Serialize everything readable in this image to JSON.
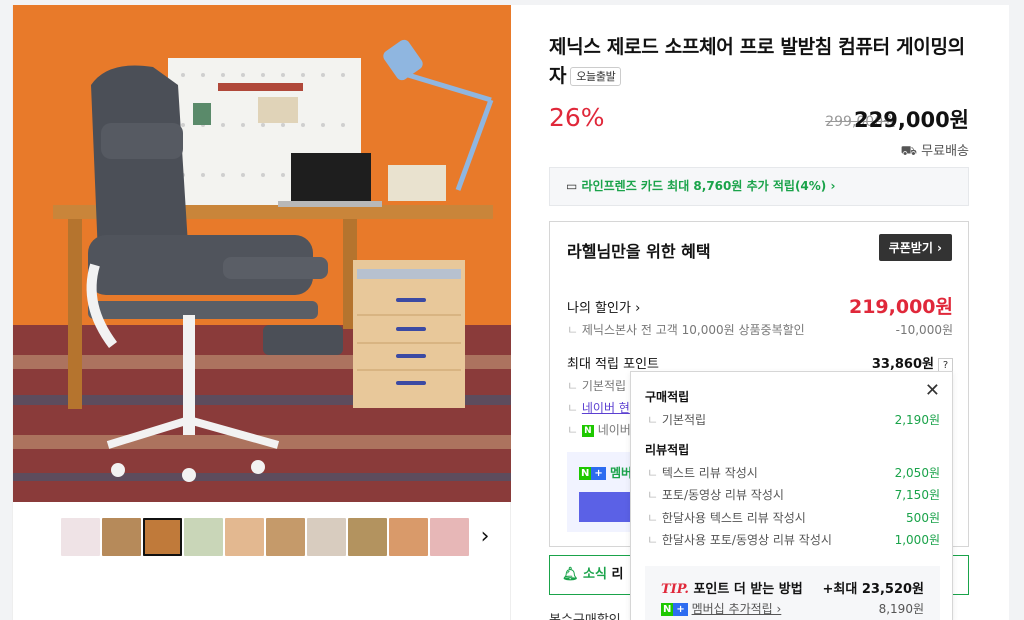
{
  "product": {
    "title": "제닉스 제로드 소프체어 프로 발받침 컴퓨터 게이밍의자",
    "badge": "오늘출발",
    "discount": "26%",
    "original_price": "299,000원",
    "price": "229,000원",
    "shipping": "무료배송"
  },
  "card_promo": "라인프렌즈 카드 최대 8,760원 추가 적립(4%) ›",
  "benefit": {
    "title": "라헬님만을 위한 혜택",
    "coupon_button": "쿠폰받기 ›",
    "my_discount_label": "나의 할인가 ›",
    "my_discount_price": "219,000원",
    "my_discount_sub": "제닉스본사 전 고객 10,000원 상품중복할인",
    "my_discount_sub_value": "-10,000원",
    "max_points_label": "최대 적립 포인트",
    "max_points_value": "33,860원",
    "basic_label": "기본적립",
    "naver_label": "네이버 현",
    "naver_pay_label": "네이버",
    "member_label": "멤버"
  },
  "popup": {
    "purchase_heading": "구매적립",
    "basic_label": "기본적립",
    "basic_value": "2,190원",
    "review_heading": "리뷰적립",
    "reviews": [
      {
        "label": "텍스트 리뷰 작성시",
        "value": "2,050원"
      },
      {
        "label": "포토/동영상 리뷰 작성시",
        "value": "7,150원"
      },
      {
        "label": "한달사용 텍스트 리뷰 작성시",
        "value": "500원"
      },
      {
        "label": "한달사용 포토/동영상 리뷰 작성시",
        "value": "1,000원"
      }
    ],
    "tip_label": "TIP.",
    "tip_title": "포인트 더 받는 방법",
    "tip_max": "+최대 23,520원",
    "tip_member": "멤버십 추가적립 ›",
    "tip_member_value": "8,190원",
    "close_icon": "close-icon"
  },
  "news": {
    "label": "소식",
    "rest": "리"
  },
  "cutoff_text": "복수구매할인",
  "thumb_next": "›"
}
